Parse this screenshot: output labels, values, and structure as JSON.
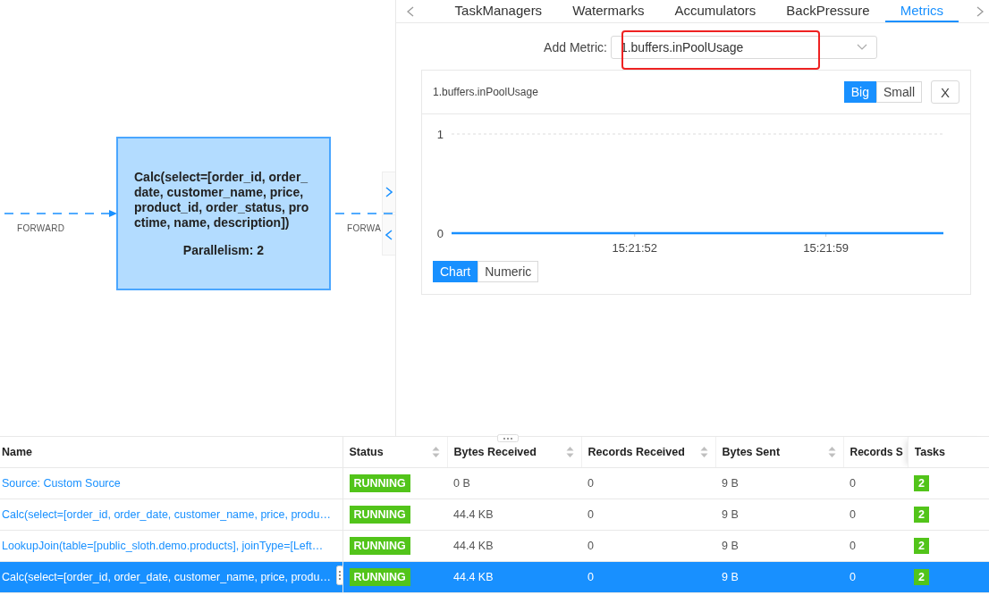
{
  "graph": {
    "edges_in": {
      "label": "FORWARD"
    },
    "node": {
      "description": "Calc(select=[order_id, order_date, customer_name, price, product_id, order_status, proctime, name, description])",
      "parallelism": "Parallelism: 2"
    },
    "edges_out": {
      "label": "FORWA"
    }
  },
  "tabs": [
    {
      "label": "TaskManagers",
      "selected": false
    },
    {
      "label": "Watermarks",
      "selected": false
    },
    {
      "label": "Accumulators",
      "selected": false
    },
    {
      "label": "BackPressure",
      "selected": false
    },
    {
      "label": "Metrics",
      "selected": true
    }
  ],
  "add_metric": {
    "label": "Add Metric:",
    "value": "1.buffers.inPoolUsage",
    "highlighted": true
  },
  "metric_card": {
    "title": "1.buffers.inPoolUsage",
    "size_buttons": [
      {
        "label": "Big",
        "selected": true
      },
      {
        "label": "Small",
        "selected": false
      }
    ],
    "close_label": "X",
    "chart_data": {
      "type": "line",
      "x": [
        55305.3,
        55323.3
      ],
      "series": [
        {
          "color": "#1890ff",
          "values": [
            0,
            0
          ]
        }
      ],
      "xlim": [
        55305.3,
        55323.3
      ],
      "ylim": [
        0,
        1
      ],
      "yticks": [
        0,
        1
      ],
      "xticks": [
        {
          "value": 55312,
          "label": "15:21:52"
        },
        {
          "value": 55319,
          "label": "15:21:59"
        }
      ]
    },
    "view_buttons": [
      {
        "label": "Chart",
        "selected": true
      },
      {
        "label": "Numeric",
        "selected": false
      }
    ]
  },
  "table": {
    "columns": [
      {
        "label": "Name",
        "sortable": false
      },
      {
        "label": "Status",
        "sortable": true
      },
      {
        "label": "Bytes Received",
        "sortable": true
      },
      {
        "label": "Records Received",
        "sortable": true
      },
      {
        "label": "Bytes Sent",
        "sortable": true
      },
      {
        "label": "Records S",
        "sortable": false
      },
      {
        "label": "Tasks",
        "sortable": false
      }
    ],
    "rows": [
      {
        "name": "Source: Custom Source",
        "status": "RUNNING",
        "bytes_received": "0 B",
        "records_received": "0",
        "bytes_sent": "9 B",
        "records_sent": "0",
        "tasks": "2",
        "selected": false
      },
      {
        "name": "Calc(select=[order_id, order_date, customer_name, price, produ…",
        "status": "RUNNING",
        "bytes_received": "44.4 KB",
        "records_received": "0",
        "bytes_sent": "9 B",
        "records_sent": "0",
        "tasks": "2",
        "selected": false
      },
      {
        "name": "LookupJoin(table=[public_sloth.demo.products], joinType=[Left…",
        "status": "RUNNING",
        "bytes_received": "44.4 KB",
        "records_received": "0",
        "bytes_sent": "9 B",
        "records_sent": "0",
        "tasks": "2",
        "selected": false
      },
      {
        "name": "Calc(select=[order_id, order_date, customer_name, price, produ…",
        "status": "RUNNING",
        "bytes_received": "44.4 KB",
        "records_received": "0",
        "bytes_sent": "9 B",
        "records_sent": "0",
        "tasks": "2",
        "selected": true
      }
    ]
  }
}
